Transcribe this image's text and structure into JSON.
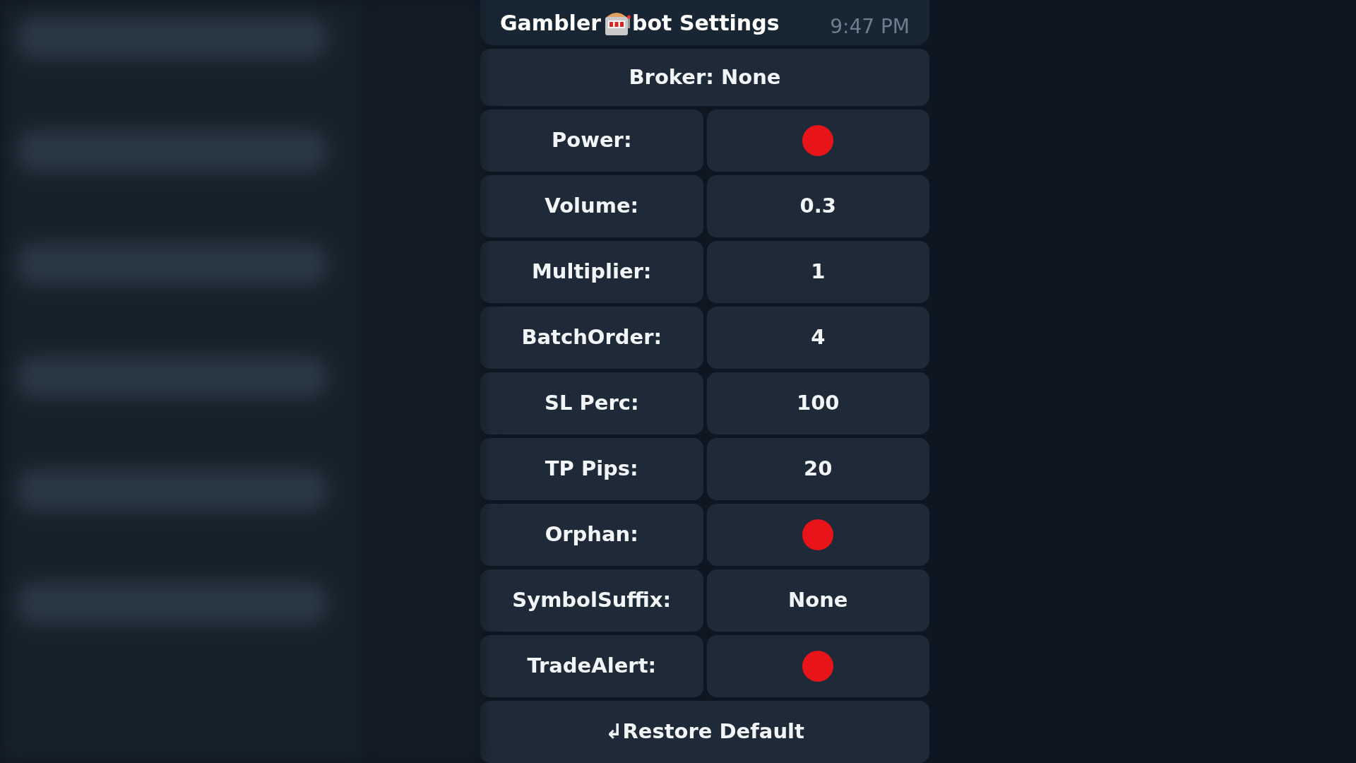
{
  "message": {
    "title_parts": [
      "Gambler",
      "bot Settings"
    ],
    "time": "9:47 PM"
  },
  "broker": {
    "label": "Broker: None"
  },
  "settings": [
    {
      "label": "Power:",
      "kind": "toggle",
      "on": false
    },
    {
      "label": "Volume:",
      "kind": "text",
      "value": "0.3"
    },
    {
      "label": "Multiplier:",
      "kind": "text",
      "value": "1"
    },
    {
      "label": "BatchOrder:",
      "kind": "text",
      "value": "4"
    },
    {
      "label": "SL Perc:",
      "kind": "text",
      "value": "100"
    },
    {
      "label": "TP Pips:",
      "kind": "text",
      "value": "20"
    },
    {
      "label": "Orphan:",
      "kind": "toggle",
      "on": false
    },
    {
      "label": "SymbolSuffix:",
      "kind": "text",
      "value": "None"
    },
    {
      "label": "TradeAlert:",
      "kind": "toggle",
      "on": false
    }
  ],
  "restore": {
    "label": "↲Restore Default"
  }
}
